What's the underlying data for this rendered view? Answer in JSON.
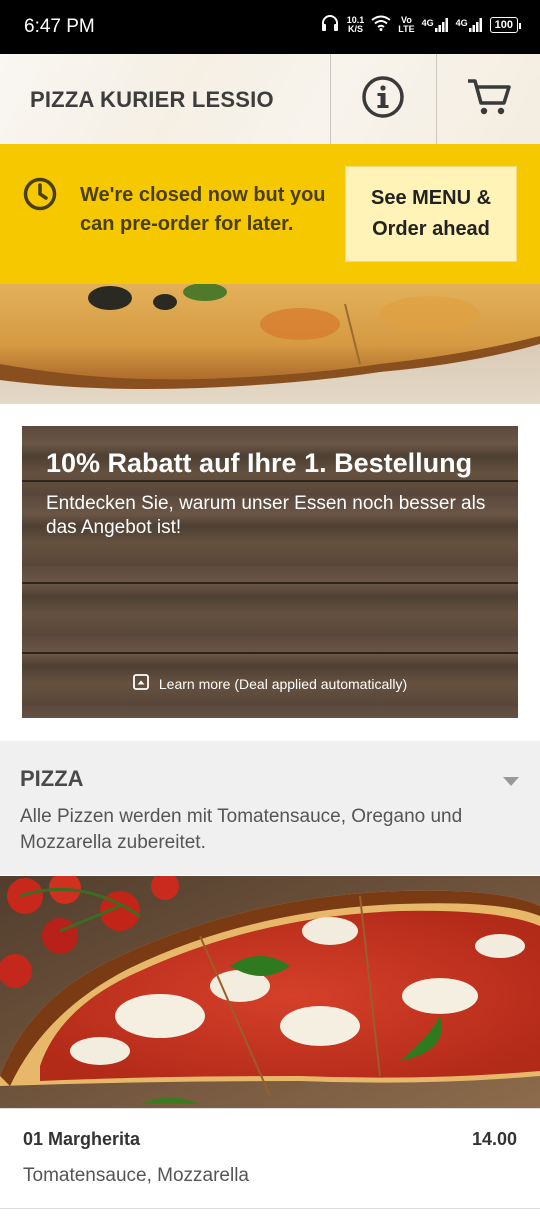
{
  "status_bar": {
    "time": "6:47 PM",
    "net_speed_top": "10.1",
    "net_speed_bottom": "K/S",
    "volte_top": "Vo",
    "volte_bottom": "LTE",
    "sig1": "4G",
    "sig2": "4G",
    "battery": "100"
  },
  "header": {
    "title": "PIZZA KURIER LESSIO",
    "info_icon": "info-icon",
    "cart_icon": "cart-icon"
  },
  "closed_banner": {
    "message": "We're closed now but you can pre-order for later.",
    "button_label": "See MENU & Order ahead",
    "bg_color": "#f6c800"
  },
  "deal": {
    "title": "10% Rabatt auf Ihre 1. Bestellung",
    "subtitle": "Entdecken Sie, warum unser Essen noch besser als das Angebot ist!",
    "learn_more": "Learn more (Deal applied automatically)"
  },
  "category": {
    "title": "PIZZA",
    "description": "Alle Pizzen werden mit Tomatensauce, Oregano und Mozzarella zubereitet."
  },
  "items": [
    {
      "name": "01 Margherita",
      "price": "14.00",
      "description": "Tomatensauce, Mozzarella"
    }
  ]
}
